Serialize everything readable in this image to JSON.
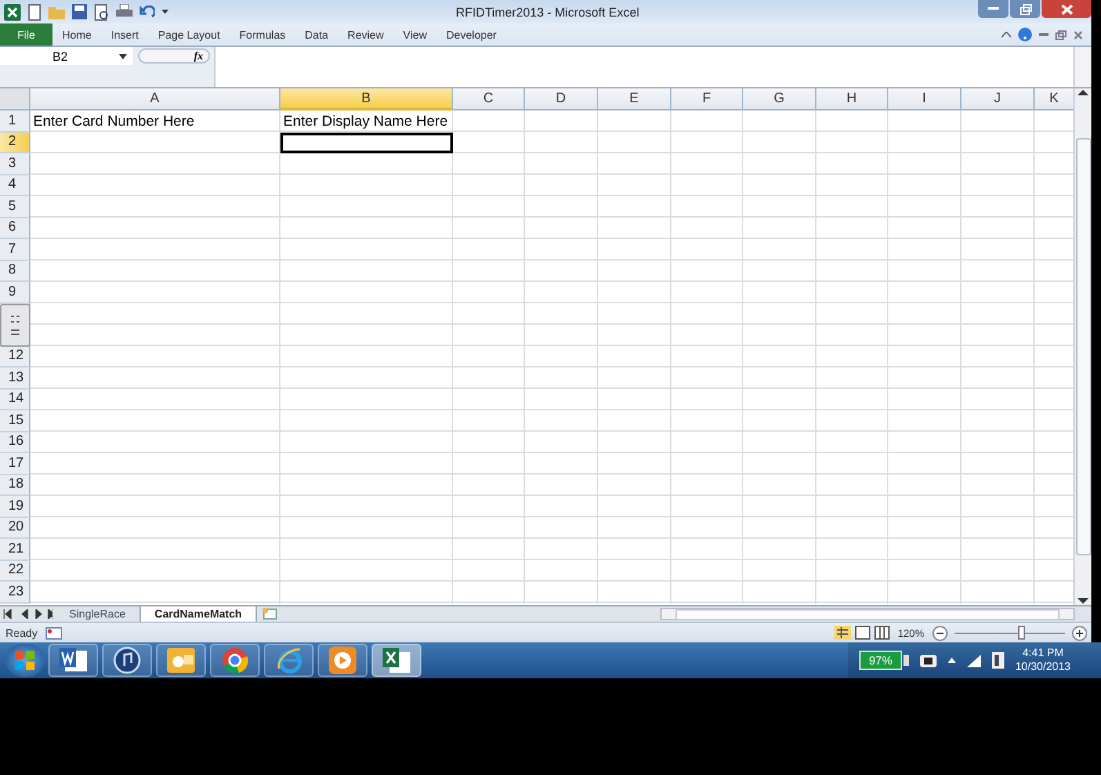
{
  "window": {
    "title": "RFIDTimer2013 - Microsoft Excel"
  },
  "ribbon_tabs": [
    {
      "label": "File",
      "kind": "file",
      "selected": false
    },
    {
      "label": "Home",
      "kind": "tab",
      "selected": false
    },
    {
      "label": "Insert",
      "kind": "tab",
      "selected": false
    },
    {
      "label": "Page Layout",
      "kind": "tab",
      "selected": false
    },
    {
      "label": "Formulas",
      "kind": "tab",
      "selected": false
    },
    {
      "label": "Data",
      "kind": "tab",
      "selected": false
    },
    {
      "label": "Review",
      "kind": "tab",
      "selected": false
    },
    {
      "label": "View",
      "kind": "tab",
      "selected": false
    },
    {
      "label": "Developer",
      "kind": "tab",
      "selected": false
    }
  ],
  "name_box": {
    "value": "B2"
  },
  "formula_bar": {
    "fx": "fx"
  },
  "columns": [
    {
      "label": "A",
      "selected": false
    },
    {
      "label": "B",
      "selected": true
    },
    {
      "label": "C",
      "selected": false
    },
    {
      "label": "D",
      "selected": false
    },
    {
      "label": "E",
      "selected": false
    },
    {
      "label": "F",
      "selected": false
    },
    {
      "label": "G",
      "selected": false
    },
    {
      "label": "H",
      "selected": false
    },
    {
      "label": "I",
      "selected": false
    },
    {
      "label": "J",
      "selected": false
    },
    {
      "label": "K",
      "selected": false
    }
  ],
  "rows": [
    {
      "number": "1",
      "selected": false,
      "cells": [
        "Enter Card Number Here",
        "Enter Display Name Here"
      ]
    },
    {
      "number": "2",
      "selected": true
    },
    {
      "number": "3",
      "selected": false
    },
    {
      "number": "4",
      "selected": false
    },
    {
      "number": "5",
      "selected": false
    },
    {
      "number": "6",
      "selected": false
    },
    {
      "number": "7",
      "selected": false
    },
    {
      "number": "8",
      "selected": false
    },
    {
      "number": "9",
      "selected": false
    },
    {},
    {},
    {
      "number": "12",
      "selected": false
    },
    {
      "number": "13",
      "selected": false
    },
    {
      "number": "14",
      "selected": false
    },
    {
      "number": "15",
      "selected": false
    },
    {
      "number": "16",
      "selected": false
    },
    {
      "number": "17",
      "selected": false
    },
    {
      "number": "18",
      "selected": false
    },
    {
      "number": "19",
      "selected": false
    },
    {
      "number": "20",
      "selected": false
    },
    {
      "number": "21",
      "selected": false
    },
    {
      "number": "22",
      "selected": false
    },
    {
      "number": "23",
      "selected": false
    }
  ],
  "sheet_tabs": [
    {
      "label": "SingleRace",
      "selected": false
    },
    {
      "label": "CardNameMatch",
      "selected": true
    }
  ],
  "status_bar": {
    "status": "Ready",
    "zoom": "120%",
    "zoom_slider": {
      "level": 0.6
    }
  },
  "taskbar": {
    "apps": [
      {
        "kind": "word",
        "selected": false
      },
      {
        "kind": "music",
        "selected": false
      },
      {
        "kind": "mail",
        "selected": false
      },
      {
        "kind": "browser",
        "selected": false
      },
      {
        "kind": "ie",
        "selected": false
      },
      {
        "kind": "player",
        "selected": false
      },
      {
        "kind": "excel",
        "selected": true
      }
    ],
    "battery": "97%",
    "time": "4:41 PM",
    "date": "10/30/2013"
  }
}
